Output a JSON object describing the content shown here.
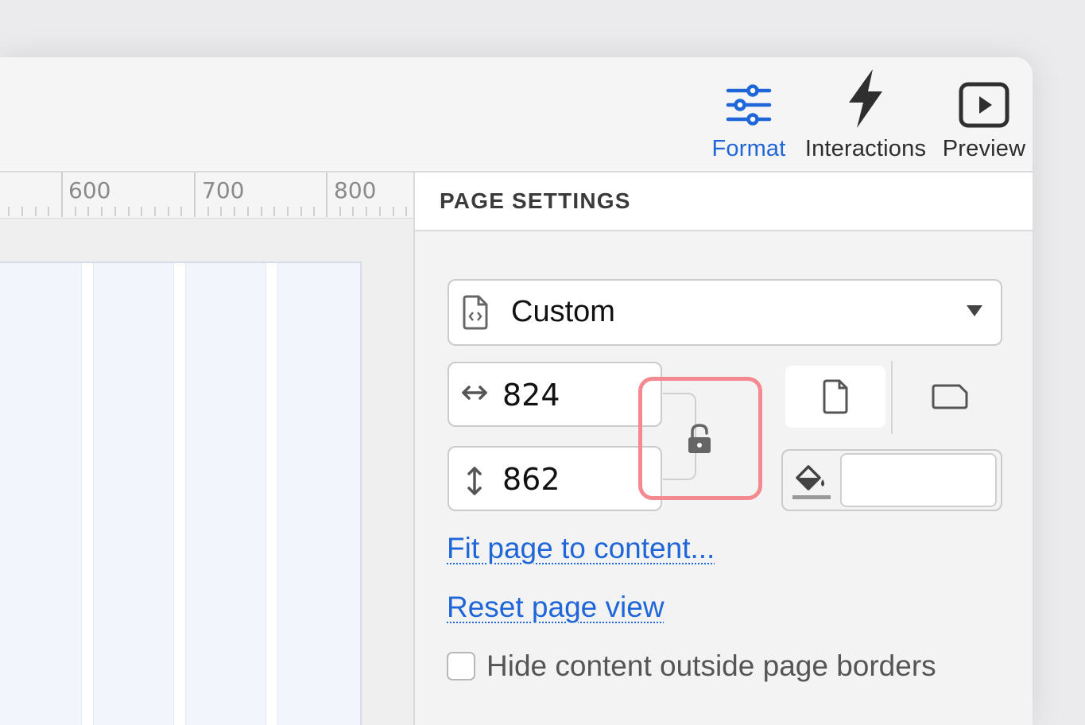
{
  "toolbar": {
    "tools": [
      {
        "label": "Format",
        "icon": "sliders-icon",
        "active": true
      },
      {
        "label": "Interactions",
        "icon": "lightning-icon",
        "active": false
      },
      {
        "label": "Preview",
        "icon": "play-icon",
        "active": false
      }
    ]
  },
  "ruler": {
    "labels": [
      "600",
      "700",
      "800"
    ]
  },
  "panel": {
    "title": "PAGE SETTINGS",
    "page_size": {
      "value": "Custom",
      "icon": "document-code-icon"
    },
    "width": {
      "value": "824",
      "icon": "horizontal-arrows-icon"
    },
    "height": {
      "value": "862",
      "icon": "vertical-arrows-icon"
    },
    "lock": {
      "icon": "unlock-icon",
      "locked": false
    },
    "orientation": {
      "portrait_icon": "portrait-page-icon",
      "landscape_icon": "landscape-page-icon",
      "selected": "portrait"
    },
    "fill": {
      "icon": "paint-bucket-icon",
      "color": "#ffffff"
    },
    "fit_link": "Fit page to content...",
    "reset_link": "Reset page view",
    "hide_content": {
      "label": "Hide content outside page borders",
      "checked": false
    }
  },
  "colors": {
    "accent": "#1f66d9",
    "highlight": "#f48a8f"
  }
}
